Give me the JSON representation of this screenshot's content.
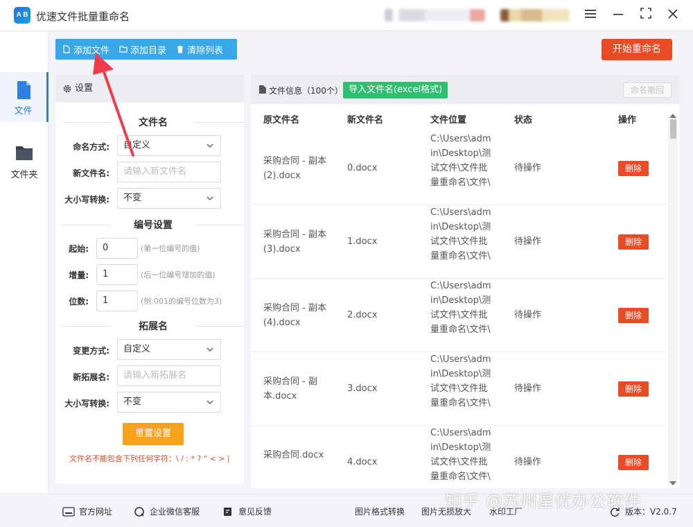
{
  "app": {
    "title": "优速文件批量重命名",
    "logo_text": "A B"
  },
  "window": {
    "menu_icon": "menu-icon",
    "minimize_icon": "minimize-icon",
    "maximize_icon": "maximize-icon",
    "close_icon": "close-icon"
  },
  "nav": {
    "items": [
      {
        "label": "文件",
        "active": true
      },
      {
        "label": "文件夹",
        "active": false
      }
    ]
  },
  "toolbar": {
    "add_file": "添加文件",
    "add_dir": "添加目录",
    "clear_list": "清除列表"
  },
  "start_button": "开始重命名",
  "settings": {
    "title": "设置",
    "filename_section": "文件名",
    "naming_mode_label": "命名方式:",
    "naming_mode_value": "自定义",
    "new_name_label": "新文件名:",
    "new_name_placeholder": "请输入新文件名",
    "case_label": "大小写转换:",
    "case_value": "不变",
    "numbering_section": "编号设置",
    "start_label": "起始:",
    "start_value": "0",
    "start_hint": "(第一位编号的值)",
    "step_label": "增量:",
    "step_value": "1",
    "step_hint": "(后一位编号增加的值)",
    "digits_label": "位数:",
    "digits_value": "1",
    "digits_hint": "(例:001的编号位数为3)",
    "ext_section": "拓展名",
    "ext_mode_label": "变更方式:",
    "ext_mode_value": "自定义",
    "new_ext_label": "新拓展名:",
    "new_ext_placeholder": "请输入新拓展名",
    "ext_case_label": "大小写转换:",
    "ext_case_value": "不变",
    "reset_button": "重置设置",
    "warning": "文件名不能包含下列任何字符：\\ / : * ? \" < > |"
  },
  "fileinfo": {
    "title": "文件信息（100个）",
    "import_button": "导入文件名(excel格式)",
    "undo_button": "命名撤回",
    "columns": [
      "原文件名",
      "新文件名",
      "文件位置",
      "状态",
      "操作"
    ],
    "rows": [
      {
        "original": "采购合同 - 副本 (2).docx",
        "new": "0.docx",
        "location": "C:\\Users\\admin\\Desktop\\测试文件\\文件批量重命名\\文件\\",
        "status": "待操作",
        "action": "删除"
      },
      {
        "original": "采购合同 - 副本 (3).docx",
        "new": "1.docx",
        "location": "C:\\Users\\admin\\Desktop\\测试文件\\文件批量重命名\\文件\\",
        "status": "待操作",
        "action": "删除"
      },
      {
        "original": "采购合同 - 副本 (4).docx",
        "new": "2.docx",
        "location": "C:\\Users\\admin\\Desktop\\测试文件\\文件批量重命名\\文件\\",
        "status": "待操作",
        "action": "删除"
      },
      {
        "original": "采购合同 - 副本.docx",
        "new": "3.docx",
        "location": "C:\\Users\\admin\\Desktop\\测试文件\\文件批量重命名\\文件\\",
        "status": "待操作",
        "action": "删除"
      },
      {
        "original": "采购合同.docx",
        "new": "4.docx",
        "location": "C:\\Users\\admin\\Desktop\\测试文件\\文件批量重命名\\文件\\",
        "status": "待操作",
        "action": "删除"
      }
    ]
  },
  "footer": {
    "website": "官方网址",
    "wechat": "企业微信客服",
    "feedback": "意见反馈",
    "img_convert": "图片格式转换",
    "img_enlarge": "图片无损放大",
    "watermark_tool": "水印工厂",
    "version": "版本：V2.0.7"
  },
  "watermark": "知乎 @苏州星优办公软件",
  "colors": {
    "accent": "#39a7e8",
    "primary_red": "#e84c27",
    "green": "#2fbf71",
    "orange": "#f5a31a",
    "nav_active": "#2d7fe0"
  }
}
